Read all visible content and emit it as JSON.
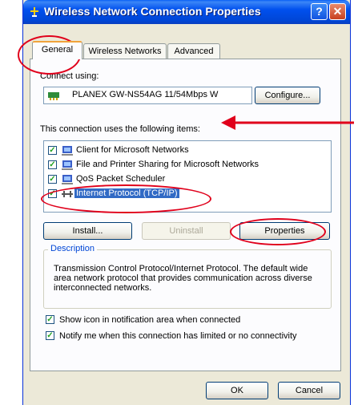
{
  "window": {
    "title": "Wireless Network Connection Properties",
    "help_glyph": "?",
    "close_glyph": "✕"
  },
  "tabs": [
    "General",
    "Wireless Networks",
    "Advanced"
  ],
  "connect": {
    "label": "Connect using:",
    "adapter": "PLANEX GW-NS54AG 11/54Mbps W",
    "configure": "Configure..."
  },
  "items": {
    "label": "This connection uses the following items:",
    "list": [
      {
        "label": "Client for Microsoft Networks",
        "checked": true
      },
      {
        "label": "File and Printer Sharing for Microsoft Networks",
        "checked": true
      },
      {
        "label": "QoS Packet Scheduler",
        "checked": true
      },
      {
        "label": "Internet Protocol (TCP/IP)",
        "checked": true,
        "selected": true
      }
    ],
    "check_glyph": "✓"
  },
  "buttons": {
    "install": "Install...",
    "uninstall": "Uninstall",
    "properties": "Properties",
    "ok": "OK",
    "cancel": "Cancel"
  },
  "description": {
    "title": "Description",
    "text": "Transmission Control Protocol/Internet Protocol. The default wide area network protocol that provides communication across diverse interconnected networks."
  },
  "options": [
    {
      "label": "Show icon in notification area when connected",
      "checked": true
    },
    {
      "label": "Notify me when this connection has limited or no connectivity",
      "checked": true
    }
  ],
  "colors": {
    "titlebar": "#0050ee",
    "annotation": "#e0001b",
    "selection": "#316ac5"
  }
}
